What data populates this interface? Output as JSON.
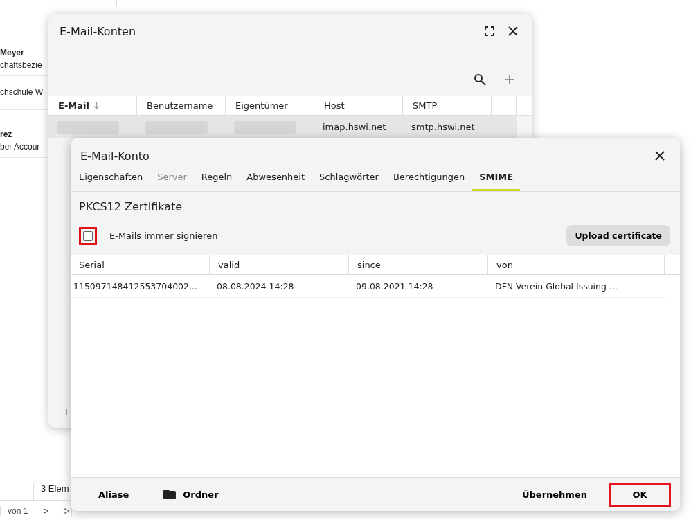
{
  "background": {
    "list_items": [
      {
        "title": "Meyer",
        "subtitle": "chaftsbezie"
      },
      {
        "subtitle": "chschule W"
      },
      {
        "title": "rez",
        "subtitle": "ber Accour"
      }
    ],
    "tab": "3 Elem",
    "pager": {
      "page_label": "von 1",
      "next": ">",
      "last": ">|"
    }
  },
  "accounts_window": {
    "title": "E-Mail-Konten",
    "columns": [
      {
        "label": "E-Mail",
        "sorted": true
      },
      {
        "label": "Benutzername",
        "sorted": false
      },
      {
        "label": "Eigentümer",
        "sorted": false
      },
      {
        "label": "Host",
        "sorted": false
      },
      {
        "label": "SMTP",
        "sorted": false
      }
    ],
    "rows": [
      {
        "selected": true,
        "host": "imap.hswi.net",
        "smtp": "smtp.hswi.net"
      }
    ],
    "footer_text": "I"
  },
  "account_dialog": {
    "title": "E-Mail-Konto",
    "tabs": [
      {
        "label": "Eigenschaften",
        "selected": false,
        "disabled": false
      },
      {
        "label": "Server",
        "selected": false,
        "disabled": true
      },
      {
        "label": "Regeln",
        "selected": false,
        "disabled": false
      },
      {
        "label": "Abwesenheit",
        "selected": false,
        "disabled": false
      },
      {
        "label": "Schlagwörter",
        "selected": false,
        "disabled": false
      },
      {
        "label": "Berechtigungen",
        "selected": false,
        "disabled": false
      },
      {
        "label": "SMIME",
        "selected": true,
        "disabled": false
      }
    ],
    "heading": "PKCS12 Zertifikate",
    "sign_checkbox": {
      "label": "E-Mails immer signieren",
      "checked": false,
      "highlighted": true
    },
    "upload_button": "Upload certificate",
    "columns": [
      "Serial",
      "valid",
      "since",
      "von"
    ],
    "rows": [
      {
        "cells": [
          "115097148412553704002...",
          "08.08.2024 14:28",
          "09.08.2021 14:28",
          "DFN-Verein Global Issuing ..."
        ]
      }
    ],
    "footer": {
      "left": [
        {
          "label": "Aliase",
          "kind": "text"
        },
        {
          "label": "Ordner",
          "kind": "folder"
        }
      ],
      "right": [
        {
          "label": "Übernehmen",
          "highlighted": false
        },
        {
          "label": "OK",
          "highlighted": true
        }
      ]
    }
  }
}
